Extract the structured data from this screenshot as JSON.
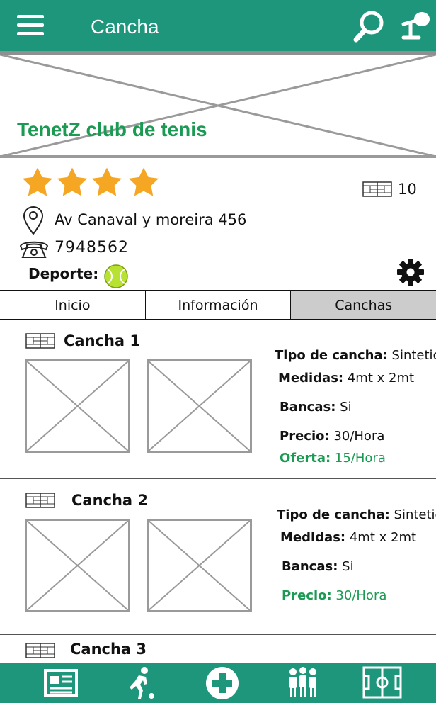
{
  "header": {
    "title": "Cancha"
  },
  "club": {
    "name": "TenetZ club de tenis",
    "rating": 4,
    "courts_count": "10",
    "address": "Av Canaval y moreira 456",
    "phone": "7948562",
    "sport_label": "Deporte:"
  },
  "tabs": [
    {
      "label": "Inicio"
    },
    {
      "label": "Información"
    },
    {
      "label": "Canchas"
    }
  ],
  "courts": [
    {
      "name": "Cancha 1",
      "type_label": "Tipo de cancha:",
      "type_value": "Sintetico",
      "size_label": "Medidas:",
      "size_value": "4mt x 2mt",
      "benches_label": "Bancas:",
      "benches_value": "Si",
      "price_label": "Precio:",
      "price_value": "30/Hora",
      "offer_label": "Oferta:",
      "offer_value": "15/Hora"
    },
    {
      "name": "Cancha 2",
      "type_label": "Tipo de cancha:",
      "type_value": "Sintetico",
      "size_label": "Medidas:",
      "size_value": "4mt x 2mt",
      "benches_label": "Bancas:",
      "benches_value": "Si",
      "price_label": "Precio:",
      "price_value": "30/Hora"
    },
    {
      "name": "Cancha 3"
    }
  ],
  "icons": {
    "menu": "menu-icon",
    "search": "search-icon",
    "mic": "microphone-icon",
    "star": "star-icon",
    "court": "court-icon",
    "pin": "location-pin-icon",
    "phone": "phone-icon",
    "ball": "tennis-ball-icon",
    "settings": "gear-icon",
    "nav": [
      "news-icon",
      "player-icon",
      "add-icon",
      "group-icon",
      "field-icon"
    ]
  },
  "colors": {
    "primary": "#1d967c",
    "accent_green": "#1a9a52",
    "star": "#f5a623"
  }
}
